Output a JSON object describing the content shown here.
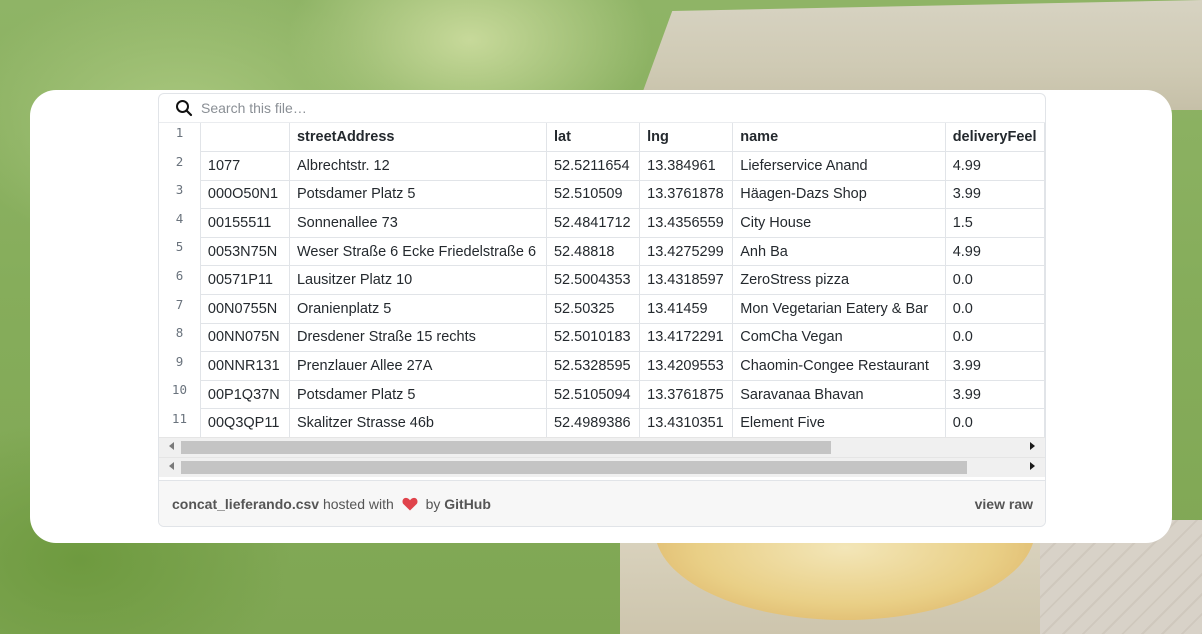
{
  "search": {
    "placeholder": "Search this file…"
  },
  "table": {
    "headers": [
      "",
      "streetAddress",
      "lat",
      "lng",
      "name",
      "deliveryFeel"
    ],
    "line_numbers": [
      "1",
      "2",
      "3",
      "4",
      "5",
      "6",
      "7",
      "8",
      "9",
      "10",
      "11"
    ],
    "rows": [
      [
        "1077",
        "Albrechtstr. 12",
        "52.5211654",
        "13.384961",
        "Lieferservice Anand",
        "4.99"
      ],
      [
        "000O50N1",
        "Potsdamer Platz 5",
        "52.510509",
        "13.3761878",
        "Häagen-Dazs Shop",
        "3.99"
      ],
      [
        "00155511",
        "Sonnenallee 73",
        "52.4841712",
        "13.4356559",
        "City House",
        "1.5"
      ],
      [
        "0053N75N",
        "Weser Straße 6 Ecke Friedelstraße 6",
        "52.48818",
        "13.4275299",
        "Anh Ba",
        "4.99"
      ],
      [
        "00571P11",
        "Lausitzer Platz 10",
        "52.5004353",
        "13.4318597",
        "ZeroStress pizza",
        "0.0"
      ],
      [
        "00N0755N",
        "Oranienplatz 5",
        "52.50325",
        "13.41459",
        "Mon Vegetarian Eatery & Bar",
        "0.0"
      ],
      [
        "00NN075N",
        "Dresdener Straße 15 rechts",
        "52.5010183",
        "13.4172291",
        "ComCha Vegan",
        "0.0"
      ],
      [
        "00NNR131",
        "Prenzlauer Allee 27A",
        "52.5328595",
        "13.4209553",
        "Chaomin-Congee Restaurant",
        "3.99"
      ],
      [
        "00P1Q37N",
        "Potsdamer Platz 5",
        "52.5105094",
        "13.3761875",
        "Saravanaa Bhavan",
        "3.99"
      ],
      [
        "00Q3QP11",
        "Skalitzer Strasse 46b",
        "52.4989386",
        "13.4310351",
        "Element Five",
        "0.0"
      ]
    ]
  },
  "footer": {
    "filename": "concat_lieferando.csv",
    "hosted_with": "hosted with",
    "by": "by",
    "github": "GitHub",
    "view_raw": "view raw"
  },
  "colors": {
    "heart": "#e0434b",
    "border": "#e1e4e8"
  }
}
